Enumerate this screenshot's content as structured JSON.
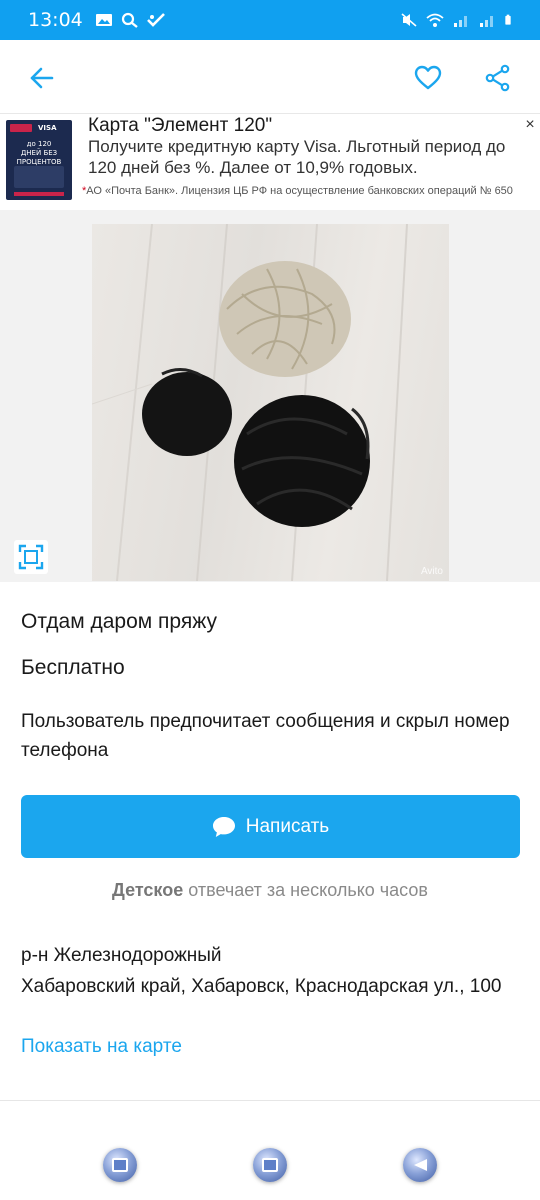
{
  "status_bar": {
    "time": "13:04",
    "background_color": "#10a0f0"
  },
  "app_bar": {
    "back_icon": "arrow-left-icon",
    "favorite_icon": "heart-icon",
    "share_icon": "share-icon",
    "accent_color": "#1ba6ee"
  },
  "ad": {
    "title": "Карта \"Элемент 120\"",
    "text": "Получите кредитную карту Visa. Льготный период до 120 дней без %. Далее от 10,9% годовых.",
    "legal_star": "*",
    "legal": "АО «Почта Банк». Лицензия ЦБ РФ на осуществление банковских операций № 650",
    "close": "×",
    "thumb": {
      "brand": "VISA",
      "headline": "до 120 ДНЕЙ БЕЗ ПРОЦЕНТОВ"
    }
  },
  "photo": {
    "watermark": "Avito",
    "expand_icon": "fullscreen-icon"
  },
  "listing": {
    "title": "Отдам даром пряжу",
    "price": "Бесплатно",
    "seller_note": "Пользователь предпочитает сообщения и скрыл номер телефона",
    "write_button": "Написать",
    "seller_name": "Детское",
    "response_time": "отвечает за несколько часов",
    "district": "р-н Железнодорожный",
    "address": "Хабаровский край, Хабаровск, Краснодарская ул., 100",
    "map_link": "Показать на карте"
  }
}
